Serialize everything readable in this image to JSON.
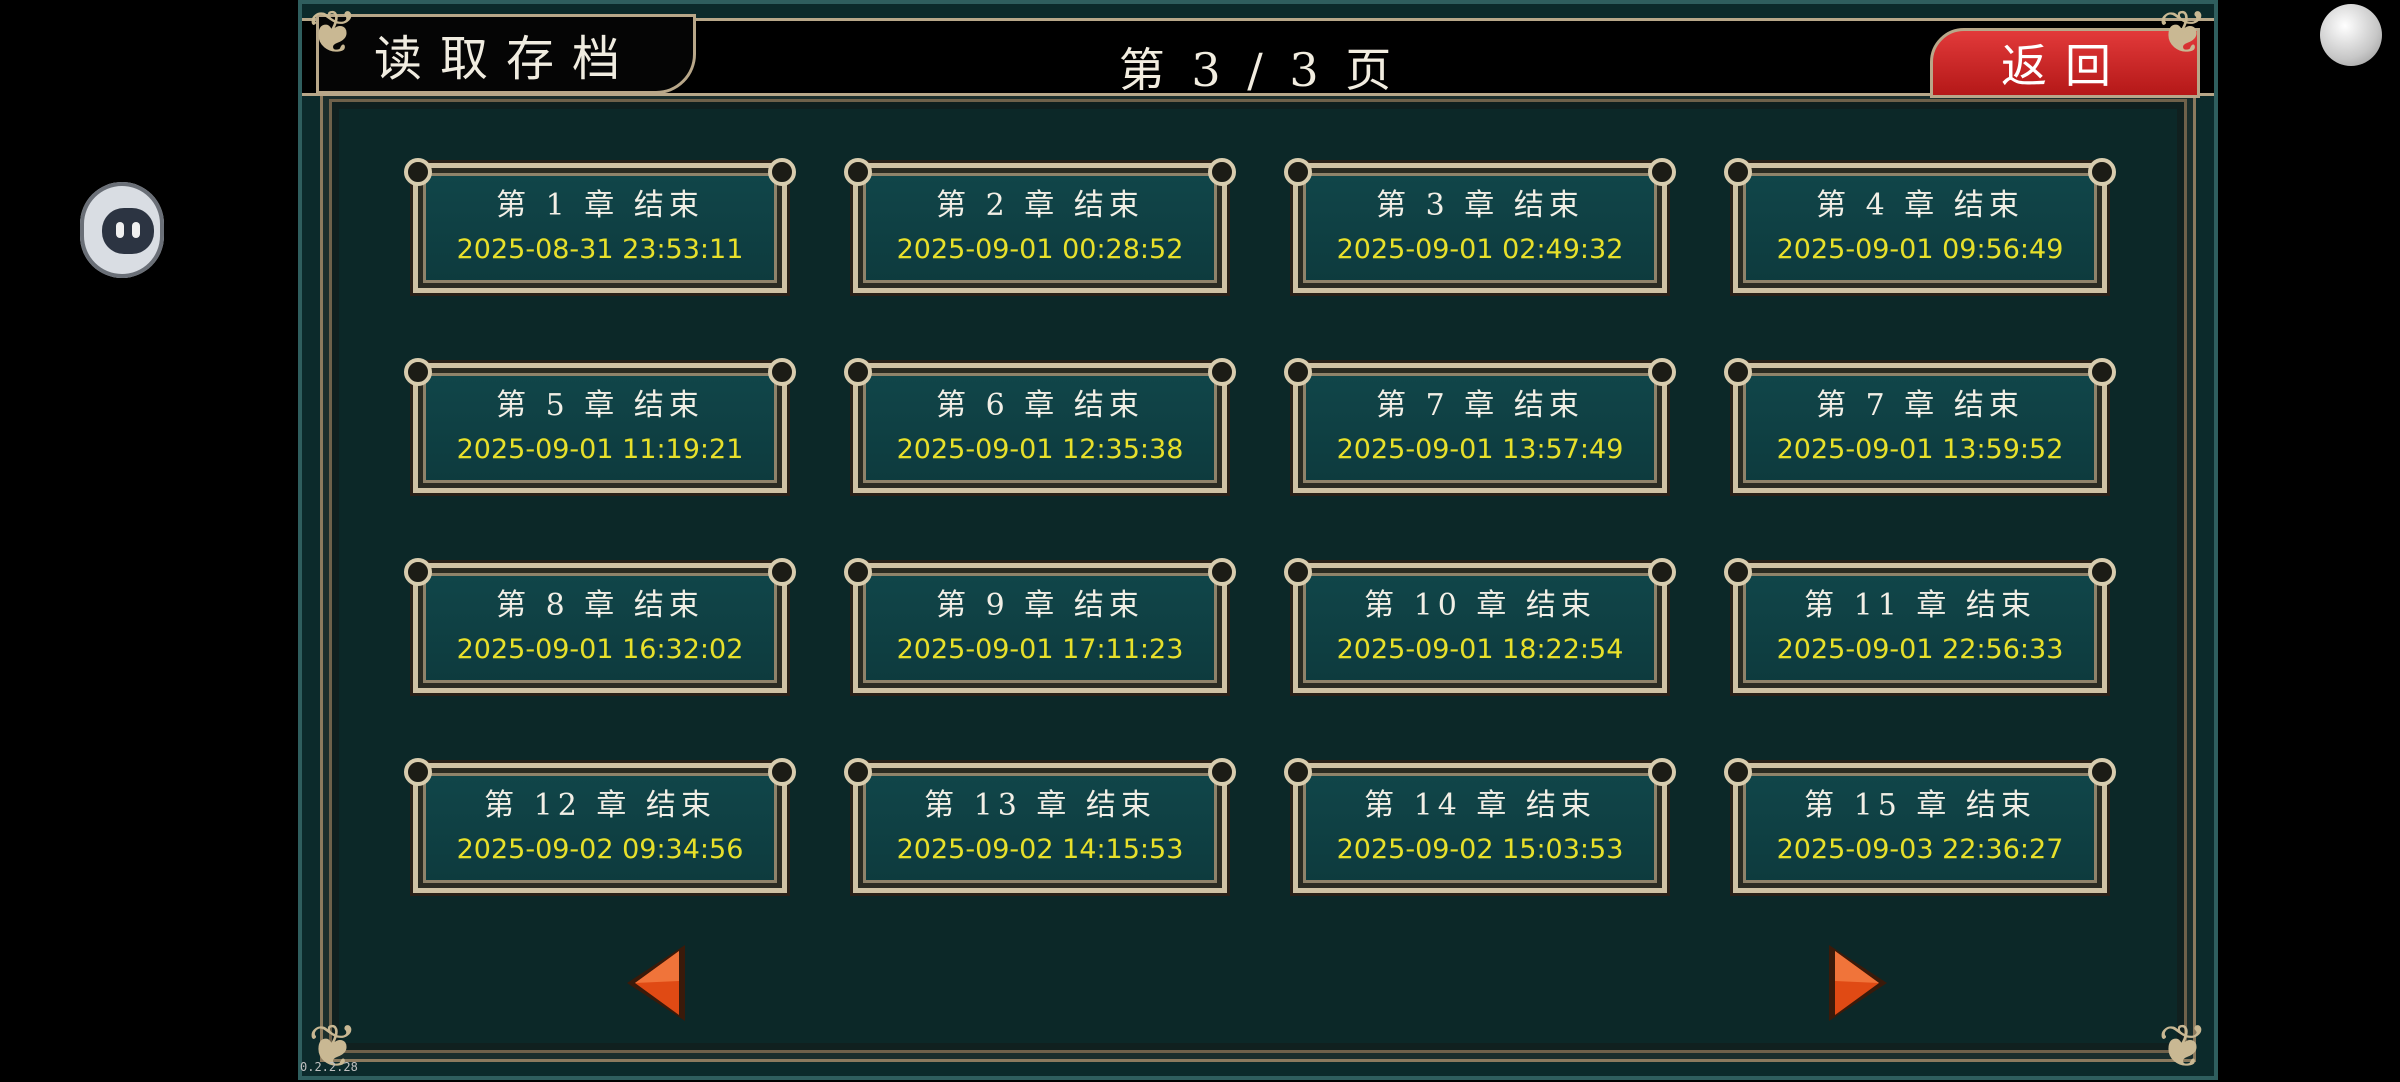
{
  "header": {
    "title": "读取存档",
    "page_indicator": "第 3 / 3 页",
    "back_label": "返回"
  },
  "slots": [
    {
      "title": "第 1 章 结束",
      "date": "2025-08-31 23:53:11"
    },
    {
      "title": "第 2 章 结束",
      "date": "2025-09-01 00:28:52"
    },
    {
      "title": "第 3 章 结束",
      "date": "2025-09-01 02:49:32"
    },
    {
      "title": "第 4 章 结束",
      "date": "2025-09-01 09:56:49"
    },
    {
      "title": "第 5 章 结束",
      "date": "2025-09-01 11:19:21"
    },
    {
      "title": "第 6 章 结束",
      "date": "2025-09-01 12:35:38"
    },
    {
      "title": "第 7 章 结束",
      "date": "2025-09-01 13:57:49"
    },
    {
      "title": "第 7 章 结束",
      "date": "2025-09-01 13:59:52"
    },
    {
      "title": "第 8 章 结束",
      "date": "2025-09-01 16:32:02"
    },
    {
      "title": "第 9 章 结束",
      "date": "2025-09-01 17:11:23"
    },
    {
      "title": "第 10 章 结束",
      "date": "2025-09-01 18:22:54"
    },
    {
      "title": "第 11 章 结束",
      "date": "2025-09-01 22:56:33"
    },
    {
      "title": "第 12 章 结束",
      "date": "2025-09-02 09:34:56"
    },
    {
      "title": "第 13 章 结束",
      "date": "2025-09-02 14:15:53"
    },
    {
      "title": "第 14 章 结束",
      "date": "2025-09-02 15:03:53"
    },
    {
      "title": "第 15 章 结束",
      "date": "2025-09-03 22:36:27"
    }
  ],
  "version": "0.2.2.28",
  "colors": {
    "panel_bg": "#0c2a2b",
    "slot_bg": "#11464a",
    "slot_title": "#f2efe6",
    "slot_date": "#e8e02a",
    "back_button": "#d42424",
    "arrow": "#e04a14"
  },
  "icons": {
    "prev": "left-triangle-arrow-icon",
    "next": "right-triangle-arrow-icon"
  }
}
